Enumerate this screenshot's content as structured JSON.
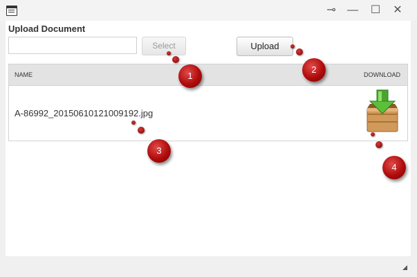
{
  "window": {
    "controls": {
      "pin": "⊸",
      "minimize": "—",
      "maximize": "☐",
      "close": "✕"
    }
  },
  "upload": {
    "title": "Upload Document",
    "input_value": "",
    "select_label": "Select",
    "upload_label": "Upload"
  },
  "grid": {
    "columns": {
      "name": "NAME",
      "download": "DOWNLOAD"
    },
    "rows": [
      {
        "name": "A-86992_20150610121009192.jpg",
        "download_icon": "download-box-icon"
      }
    ]
  },
  "markers": [
    "1",
    "2",
    "3",
    "4"
  ],
  "colors": {
    "marker": "#b00c0c",
    "header_bg": "#e3e3e3",
    "arrow": "#4aa52e",
    "box": "#d19a5a"
  }
}
